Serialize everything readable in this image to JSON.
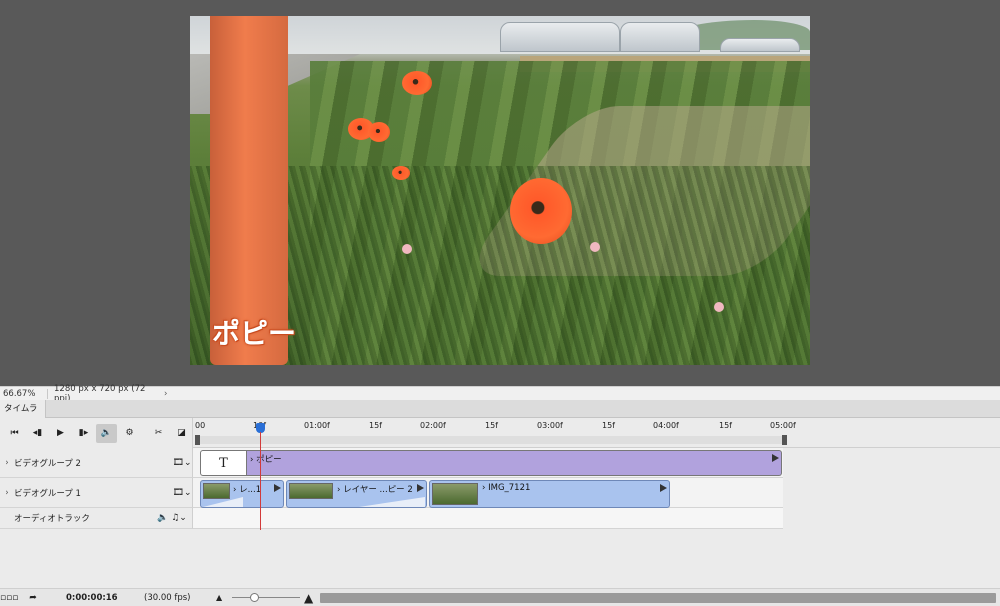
{
  "preview": {
    "overlay_text": "ポピー"
  },
  "status": {
    "zoom": "66.67%",
    "dimensions": "1280 px x 720 px (72 ppi)",
    "chevron": "›"
  },
  "timeline": {
    "tab_label": "タイムライン",
    "controls": {
      "first_frame": "⏮",
      "prev_frame": "◂▮",
      "play": "▶",
      "next_frame": "▮▸",
      "audio": "🔈",
      "settings": "⚙",
      "cut": "✂",
      "transition": "◪"
    },
    "ruler": {
      "labels": [
        "00",
        "10f",
        "01:00f",
        "15f",
        "02:00f",
        "15f",
        "03:00f",
        "15f",
        "04:00f",
        "15f",
        "05:00f"
      ]
    },
    "tracks": [
      {
        "caret": "›",
        "name": "ビデオグループ 2",
        "icon": "🎞⌄"
      },
      {
        "caret": "›",
        "name": "ビデオグループ 1",
        "icon": "🎞⌄"
      },
      {
        "caret": "",
        "name": "オーディオトラック",
        "icon": "🔈 ♫⌄"
      }
    ],
    "clips": {
      "title_clip": {
        "glyph": "T",
        "label": "› ポピー"
      },
      "video_clips": [
        {
          "label": "› レ...1"
        },
        {
          "label": "› レイヤー ...ピー 2"
        },
        {
          "label": "› IMG_7121"
        }
      ]
    }
  },
  "bottom": {
    "timecode": "0:00:00:16",
    "fps": "(30.00 fps)"
  }
}
